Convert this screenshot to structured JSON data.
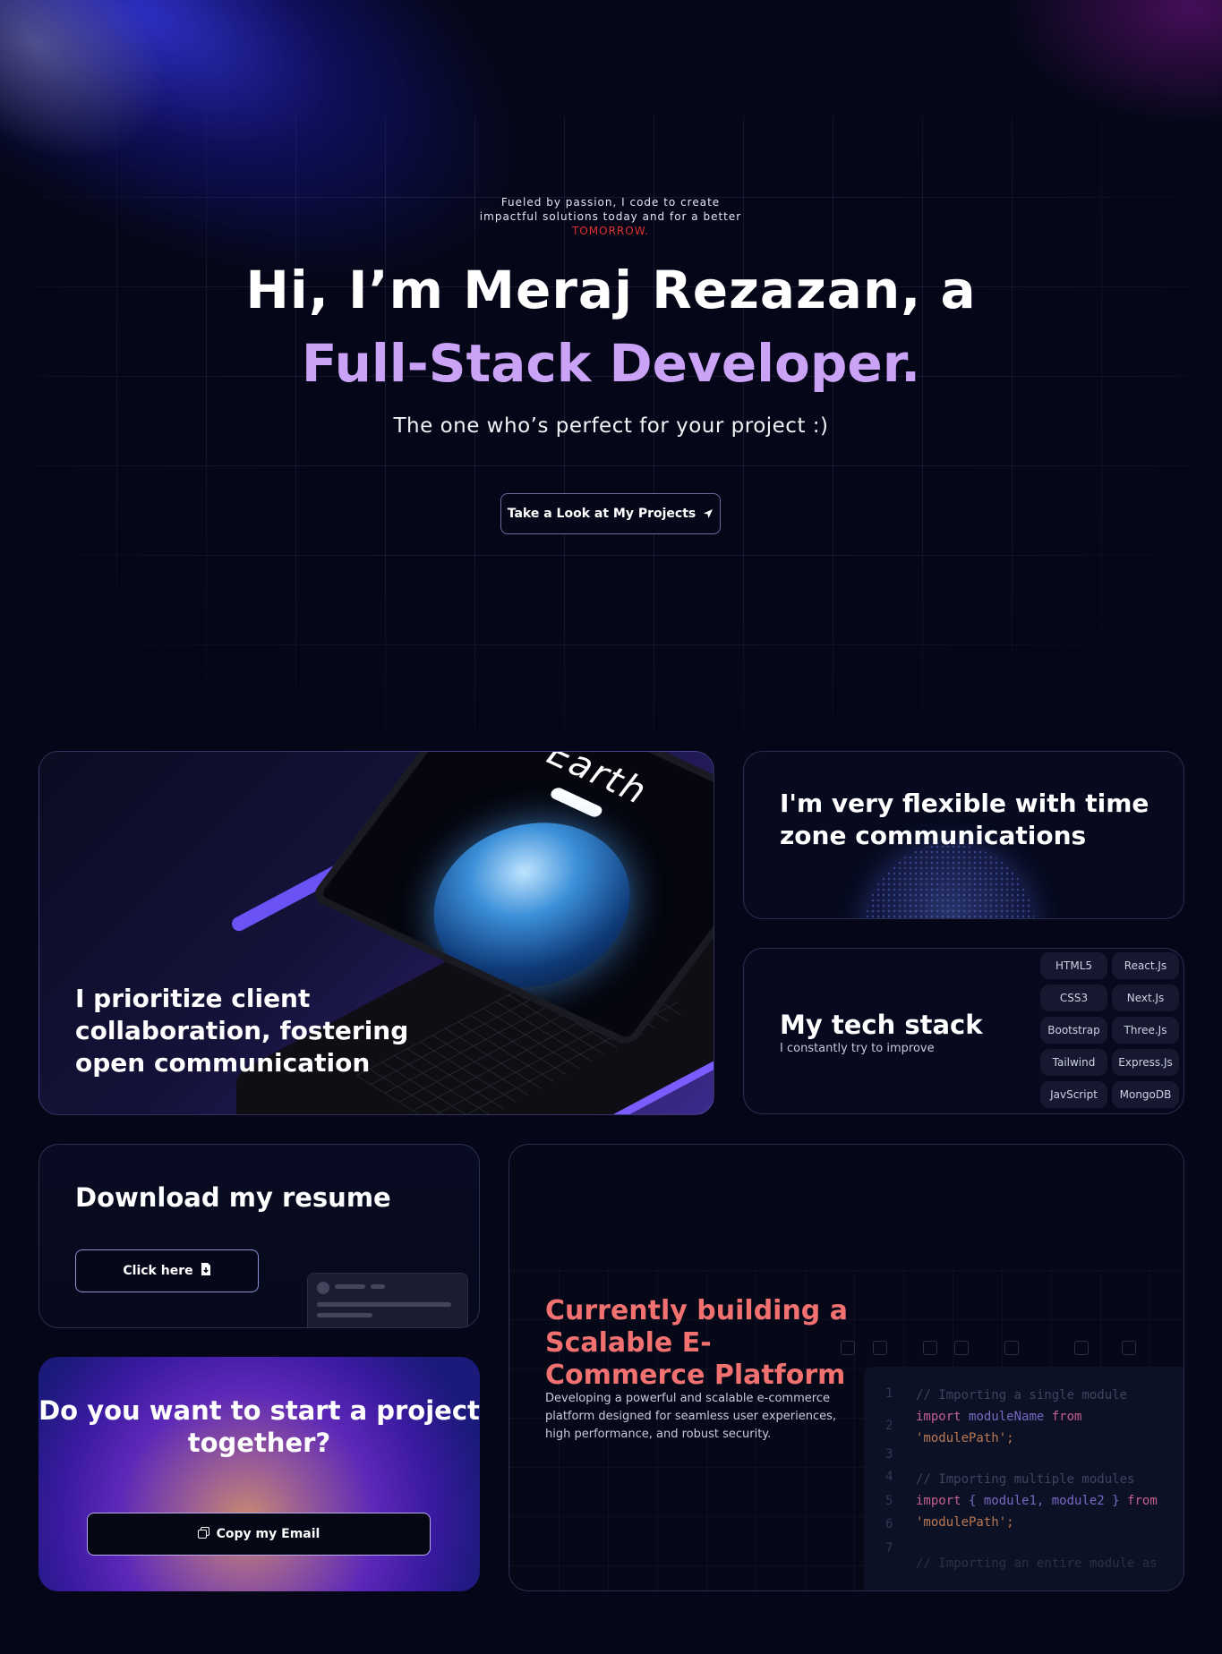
{
  "hero": {
    "tagline": "Fueled by passion, I code to create impactful solutions today and for a better",
    "tagline_highlight": "TOMORROW.",
    "headline": "Hi, I’m Meraj Rezazan, a",
    "role": "Full-Stack Developer.",
    "subtitle": "The one who’s perfect for your project :)",
    "cta_label": "Take a Look at My Projects",
    "cta_icon": "location-arrow-icon"
  },
  "cards": {
    "collaboration": {
      "title": "I prioritize client collaboration, fostering open communication",
      "screen_title": "Earth"
    },
    "timezone": {
      "title": "I'm very flexible with time zone communications"
    },
    "tech_stack": {
      "title": "My tech stack",
      "subtitle": "I constantly try to improve",
      "left": [
        "HTML5",
        "CSS3",
        "Bootstrap",
        "Tailwind",
        "JavScript"
      ],
      "right": [
        "React.Js",
        "Next.Js",
        "Three.Js",
        "Express.Js",
        "MongoDB"
      ]
    },
    "resume": {
      "title": "Download my resume",
      "button_label": "Click here",
      "button_icon": "file-download-icon"
    },
    "contact": {
      "title": "Do you want to start a project together?",
      "button_label": "Copy my Email",
      "button_icon": "copy-icon"
    },
    "building": {
      "title": "Currently building a Scalable E-Commerce Platform",
      "description": "Developing a powerful and scalable e-commerce platform designed for seamless user experiences, high performance, and robust security.",
      "code": {
        "line_numbers": [
          "1",
          "2",
          "3",
          "4",
          "5",
          "6",
          "7"
        ],
        "comment1": "// Importing a single module",
        "import1_kw": "import",
        "import1_id": "moduleName",
        "import1_from": "from",
        "import1_path": "'modulePath';",
        "comment2": "// Importing multiple modules",
        "import2_kw": "import",
        "import2_ids": "{ module1, module2 }",
        "import2_from": "from",
        "import2_path": "'modulePath';",
        "comment3": "// Importing an entire module as"
      }
    }
  },
  "colors": {
    "accent_purple": "#caa3f7",
    "accent_red": "#e0302f",
    "building_title": "#f17070",
    "background": "#050718"
  }
}
